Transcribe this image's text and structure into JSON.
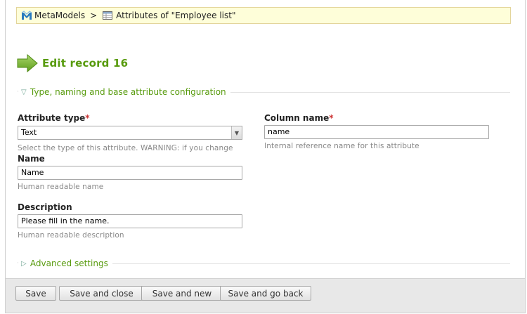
{
  "breadcrumb": {
    "app_label": "MetaModels",
    "separator": ">",
    "current_label": "Attributes of \"Employee list\""
  },
  "heading": {
    "title": "Edit record 16"
  },
  "sections": {
    "main_legend": "Type, naming and base attribute configuration",
    "advanced_legend": "Advanced settings"
  },
  "fields": {
    "attribute_type": {
      "label": "Attribute type",
      "required_mark": "*",
      "value": "Text",
      "help": "Select the type of this attribute. WARNING: if you change"
    },
    "column_name": {
      "label": "Column name",
      "required_mark": "*",
      "value": "name",
      "help": "Internal reference name for this attribute"
    },
    "name": {
      "label": "Name",
      "value": "Name",
      "help": "Human readable name"
    },
    "description": {
      "label": "Description",
      "value": "Please fill in the name.",
      "help": "Human readable description"
    }
  },
  "footer": {
    "save": "Save",
    "save_close": "Save and close",
    "save_new": "Save and new",
    "save_back": "Save and go back"
  },
  "colors": {
    "accent_green": "#589b0e",
    "breadcrumb_bg": "#fefed9",
    "required_red": "#c33333"
  },
  "icons": {
    "app": "metamodels-logo-icon",
    "table": "table-icon",
    "heading": "green-arrow-icon",
    "section_open": "triangle-down-icon",
    "section_closed": "triangle-right-icon",
    "dropdown": "chevron-down-icon"
  }
}
